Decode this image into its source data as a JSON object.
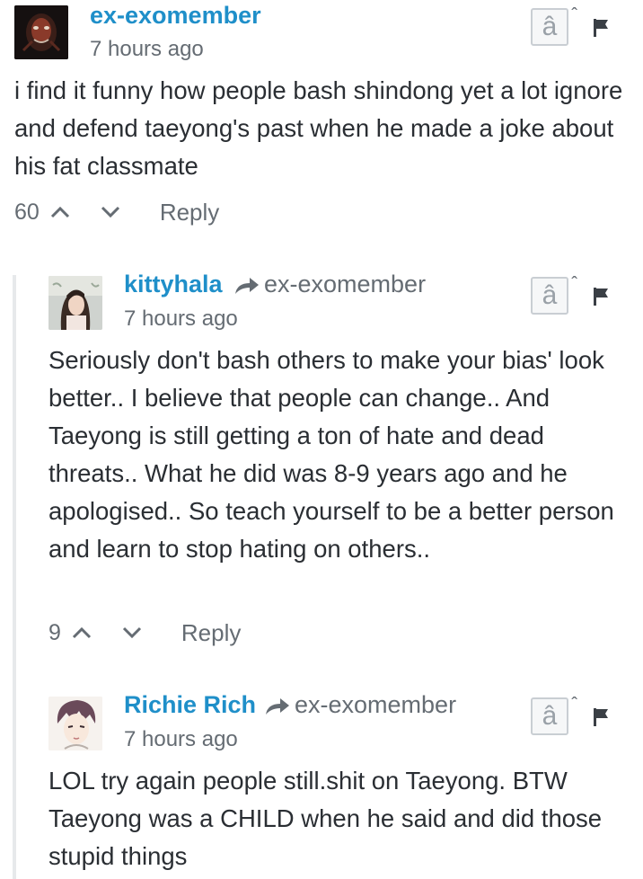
{
  "comments": [
    {
      "author": "ex-exomember",
      "reply_to": "",
      "time": "7 hours ago",
      "text": "i find it funny how people bash shindong yet a lot ignore and defend taeyong's past when he made a joke about his fat classmate",
      "votes": "60",
      "reply_label": "Reply",
      "collapse_glyph": "â",
      "avatar_icon": "dark-avatar-icon"
    },
    {
      "author": "kittyhala",
      "reply_to": "ex-exomember",
      "time": "7 hours ago",
      "text": "Seriously don't bash others to make your bias' look better.. I believe that people can change.. And Taeyong is still getting a ton of hate and dead threats.. What he did was 8-9 years ago and he apologised.. So teach yourself to be a better person and learn to stop hating on others..",
      "votes": "9",
      "reply_label": "Reply",
      "collapse_glyph": "â",
      "avatar_icon": "photo-avatar-icon"
    },
    {
      "author": "Richie Rich",
      "reply_to": "ex-exomember",
      "time": "7 hours ago",
      "text": "LOL try again people still.shit on Taeyong. BTW Taeyong was a CHILD when he said and did those stupid things",
      "votes": "",
      "reply_label": "",
      "collapse_glyph": "â",
      "avatar_icon": "anime-avatar-icon"
    }
  ],
  "colors": {
    "author": "#1f8fc9",
    "meta": "#656c73",
    "text": "#2a2e33",
    "thread_line": "#e7e9eb"
  }
}
